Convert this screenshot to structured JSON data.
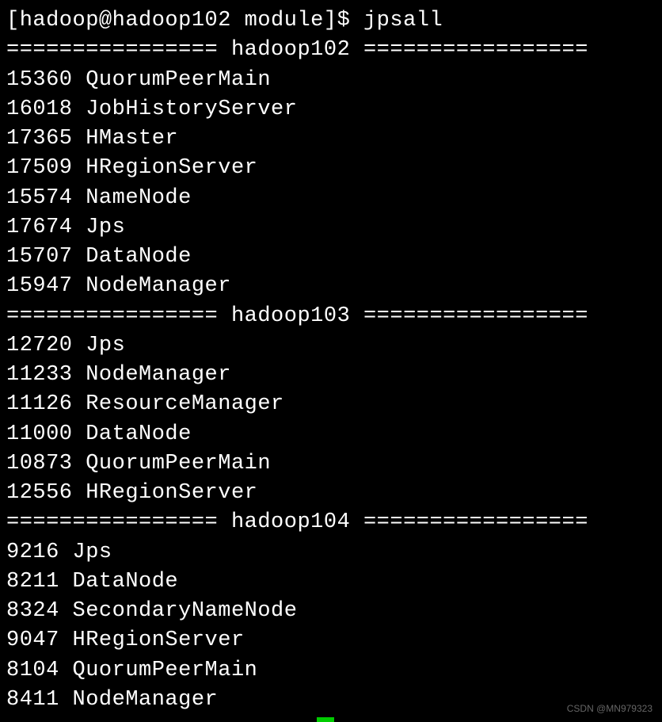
{
  "prompt": {
    "user": "hadoop",
    "host": "hadoop102",
    "dir": "module",
    "symbol": "$",
    "command": "jpsall"
  },
  "hosts": [
    {
      "name": "hadoop102",
      "separator_prefix": "================",
      "separator_suffix": "=================",
      "processes": [
        {
          "pid": "15360",
          "name": "QuorumPeerMain"
        },
        {
          "pid": "16018",
          "name": "JobHistoryServer"
        },
        {
          "pid": "17365",
          "name": "HMaster"
        },
        {
          "pid": "17509",
          "name": "HRegionServer"
        },
        {
          "pid": "15574",
          "name": "NameNode"
        },
        {
          "pid": "17674",
          "name": "Jps"
        },
        {
          "pid": "15707",
          "name": "DataNode"
        },
        {
          "pid": "15947",
          "name": "NodeManager"
        }
      ]
    },
    {
      "name": "hadoop103",
      "separator_prefix": "================",
      "separator_suffix": "=================",
      "processes": [
        {
          "pid": "12720",
          "name": "Jps"
        },
        {
          "pid": "11233",
          "name": "NodeManager"
        },
        {
          "pid": "11126",
          "name": "ResourceManager"
        },
        {
          "pid": "11000",
          "name": "DataNode"
        },
        {
          "pid": "10873",
          "name": "QuorumPeerMain"
        },
        {
          "pid": "12556",
          "name": "HRegionServer"
        }
      ]
    },
    {
      "name": "hadoop104",
      "separator_prefix": "================",
      "separator_suffix": "=================",
      "processes": [
        {
          "pid": "9216",
          "name": "Jps"
        },
        {
          "pid": "8211",
          "name": "DataNode"
        },
        {
          "pid": "8324",
          "name": "SecondaryNameNode"
        },
        {
          "pid": "9047",
          "name": "HRegionServer"
        },
        {
          "pid": "8104",
          "name": "QuorumPeerMain"
        },
        {
          "pid": "8411",
          "name": "NodeManager"
        }
      ]
    }
  ],
  "watermark": "CSDN @MN979323"
}
